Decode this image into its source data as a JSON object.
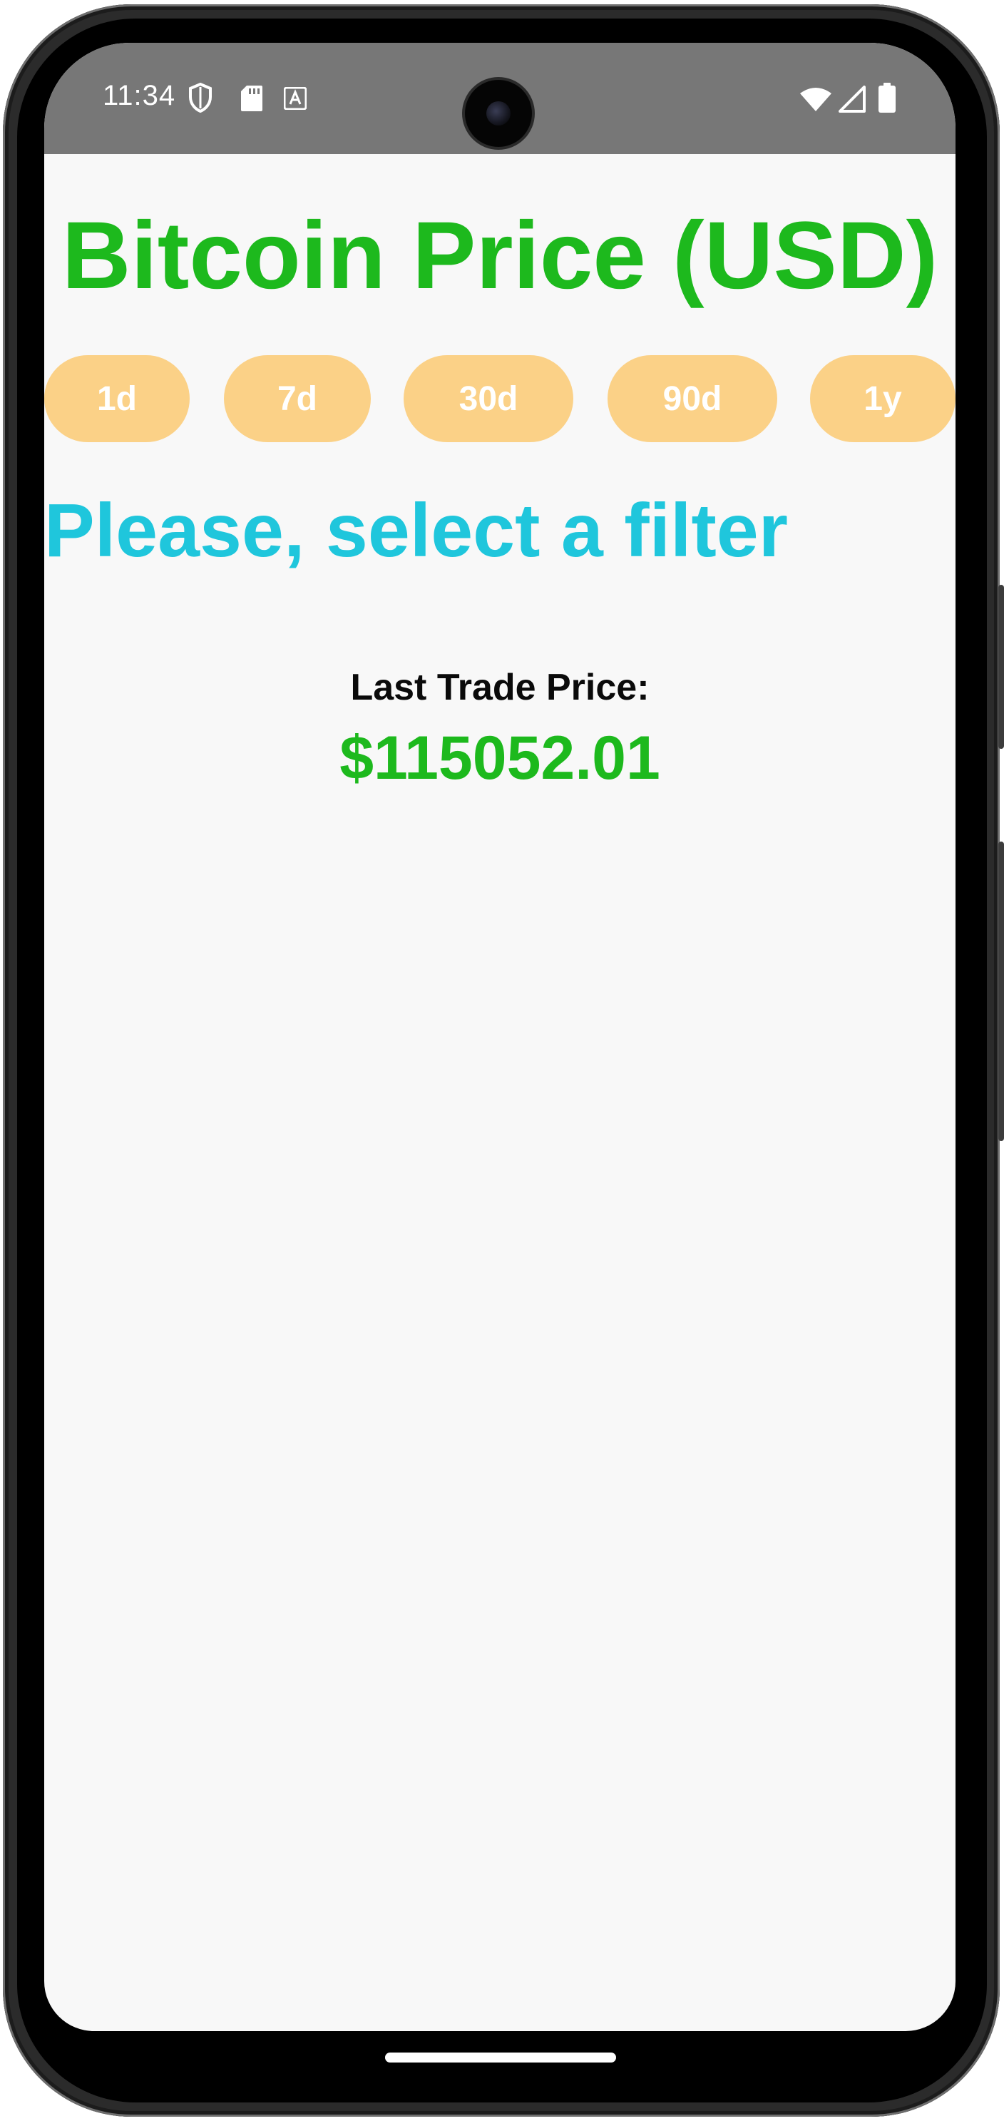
{
  "status_bar": {
    "time": "11:34",
    "left_icons": [
      "shield-icon",
      "sd-card-icon",
      "font-a-icon"
    ],
    "right_icons": [
      "wifi-icon",
      "signal-icon",
      "battery-icon"
    ]
  },
  "app": {
    "title": "Bitcoin Price (USD)",
    "filters": [
      {
        "label": "1d"
      },
      {
        "label": "7d"
      },
      {
        "label": "30d"
      },
      {
        "label": "90d"
      },
      {
        "label": "1y"
      }
    ],
    "prompt": "Please, select a filter",
    "last_trade_label": "Last Trade Price:",
    "last_trade_value": "$115052.01"
  },
  "colors": {
    "title_green": "#1db91d",
    "chip_orange": "#fbd187",
    "prompt_cyan": "#1fc6dc",
    "status_bar": "#777777",
    "screen_bg": "#f8f8f8"
  }
}
